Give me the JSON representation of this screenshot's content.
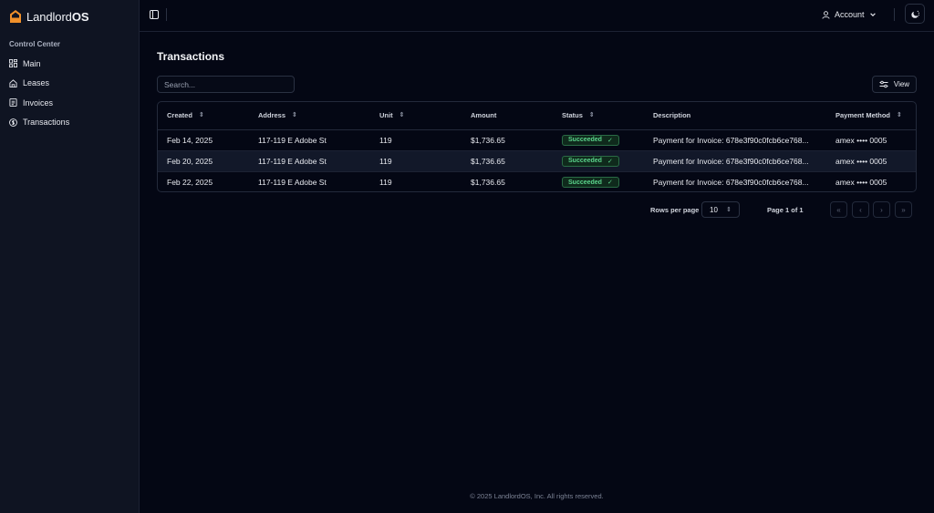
{
  "brand": {
    "name_light": "Landlord",
    "name_bold": "OS"
  },
  "sidebar": {
    "section_label": "Control Center",
    "items": [
      {
        "label": "Main",
        "icon": "grid-icon"
      },
      {
        "label": "Leases",
        "icon": "home-icon"
      },
      {
        "label": "Invoices",
        "icon": "file-icon"
      },
      {
        "label": "Transactions",
        "icon": "dollar-icon"
      }
    ]
  },
  "header": {
    "account_label": "Account"
  },
  "page": {
    "title": "Transactions"
  },
  "search": {
    "placeholder": "Search..."
  },
  "toolbar": {
    "view_label": "View"
  },
  "table": {
    "columns": [
      "Created",
      "Address",
      "Unit",
      "Amount",
      "Status",
      "Description",
      "Payment Method"
    ],
    "rows": [
      {
        "created": "Feb 14, 2025",
        "address": "117-119 E Adobe St",
        "unit": "119",
        "amount": "$1,736.65",
        "status": "Succeeded",
        "description": "Payment for Invoice: 678e3f90c0fcb6ce768...",
        "payment_method": "amex •••• 0005"
      },
      {
        "created": "Feb 20, 2025",
        "address": "117-119 E Adobe St",
        "unit": "119",
        "amount": "$1,736.65",
        "status": "Succeeded",
        "description": "Payment for Invoice: 678e3f90c0fcb6ce768...",
        "payment_method": "amex •••• 0005"
      },
      {
        "created": "Feb 22, 2025",
        "address": "117-119 E Adobe St",
        "unit": "119",
        "amount": "$1,736.65",
        "status": "Succeeded",
        "description": "Payment for Invoice: 678e3f90c0fcb6ce768...",
        "payment_method": "amex •••• 0005"
      }
    ]
  },
  "pagination": {
    "rows_label": "Rows per page",
    "rows_value": "10",
    "page_info": "Page 1 of 1"
  },
  "footer": {
    "text": "© 2025 LandlordOS, Inc. All rights reserved."
  },
  "colors": {
    "background": "#040714",
    "sidebar": "#0f1422",
    "accent": "#f0902a",
    "success": "#5bd48c"
  }
}
